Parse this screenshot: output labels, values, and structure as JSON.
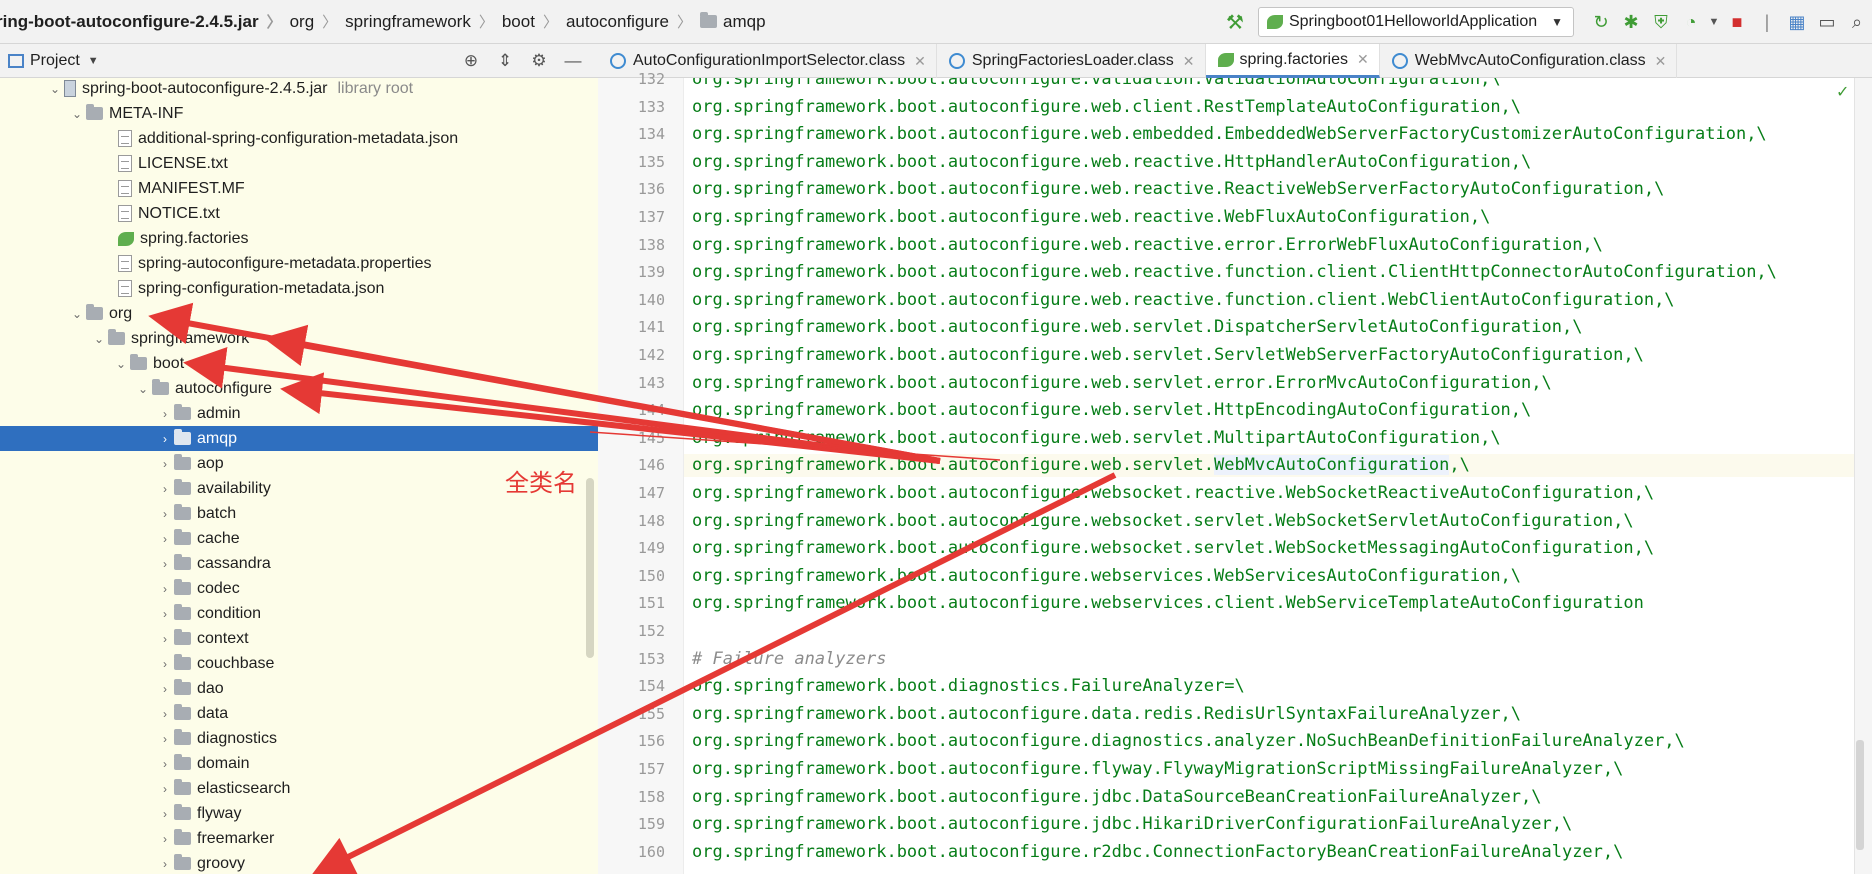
{
  "breadcrumb": {
    "items": [
      "ring-boot-autoconfigure-2.4.5.jar",
      "org",
      "springframework",
      "boot",
      "autoconfigure",
      "amqp"
    ]
  },
  "toolbar": {
    "run_config": "Springboot01HelloworldApplication"
  },
  "project_panel": {
    "title": "Project"
  },
  "tree": {
    "jar": {
      "label": "spring-boot-autoconfigure-2.4.5.jar",
      "suffix": "library root"
    },
    "meta_inf": "META-INF",
    "files": [
      "additional-spring-configuration-metadata.json",
      "LICENSE.txt",
      "MANIFEST.MF",
      "NOTICE.txt",
      "spring.factories",
      "spring-autoconfigure-metadata.properties",
      "spring-configuration-metadata.json"
    ],
    "org": "org",
    "springframework": "springframework",
    "boot": "boot",
    "autoconfigure": "autoconfigure",
    "packages": [
      "admin",
      "amqp",
      "aop",
      "availability",
      "batch",
      "cache",
      "cassandra",
      "codec",
      "condition",
      "context",
      "couchbase",
      "dao",
      "data",
      "diagnostics",
      "domain",
      "elasticsearch",
      "flyway",
      "freemarker",
      "groovy"
    ],
    "selected": "amqp"
  },
  "tabs": [
    {
      "label": "AutoConfigurationImportSelector.class",
      "active": false
    },
    {
      "label": "SpringFactoriesLoader.class",
      "active": false
    },
    {
      "label": "spring.factories",
      "active": true
    },
    {
      "label": "WebMvcAutoConfiguration.class",
      "active": false
    }
  ],
  "editor": {
    "lines": [
      {
        "n": "132",
        "text": "org.springframework.boot.autoconfigure.validation.ValidationAutoConfiguration,\\"
      },
      {
        "n": "133",
        "text": "org.springframework.boot.autoconfigure.web.client.RestTemplateAutoConfiguration,\\"
      },
      {
        "n": "134",
        "text": "org.springframework.boot.autoconfigure.web.embedded.EmbeddedWebServerFactoryCustomizerAutoConfiguration,\\"
      },
      {
        "n": "135",
        "text": "org.springframework.boot.autoconfigure.web.reactive.HttpHandlerAutoConfiguration,\\"
      },
      {
        "n": "136",
        "text": "org.springframework.boot.autoconfigure.web.reactive.ReactiveWebServerFactoryAutoConfiguration,\\"
      },
      {
        "n": "137",
        "text": "org.springframework.boot.autoconfigure.web.reactive.WebFluxAutoConfiguration,\\"
      },
      {
        "n": "138",
        "text": "org.springframework.boot.autoconfigure.web.reactive.error.ErrorWebFluxAutoConfiguration,\\"
      },
      {
        "n": "139",
        "text": "org.springframework.boot.autoconfigure.web.reactive.function.client.ClientHttpConnectorAutoConfiguration,\\"
      },
      {
        "n": "140",
        "text": "org.springframework.boot.autoconfigure.web.reactive.function.client.WebClientAutoConfiguration,\\"
      },
      {
        "n": "141",
        "text": "org.springframework.boot.autoconfigure.web.servlet.DispatcherServletAutoConfiguration,\\"
      },
      {
        "n": "142",
        "text": "org.springframework.boot.autoconfigure.web.servlet.ServletWebServerFactoryAutoConfiguration,\\"
      },
      {
        "n": "143",
        "text": "org.springframework.boot.autoconfigure.web.servlet.error.ErrorMvcAutoConfiguration,\\"
      },
      {
        "n": "144",
        "text": "org.springframework.boot.autoconfigure.web.servlet.HttpEncodingAutoConfiguration,\\"
      },
      {
        "n": "145",
        "text": "org.springframework.boot.autoconfigure.web.servlet.MultipartAutoConfiguration,\\"
      },
      {
        "n": "146",
        "text": "org.springframework.boot.autoconfigure.web.servlet.WebMvcAutoConfiguration,\\"
      },
      {
        "n": "147",
        "text": "org.springframework.boot.autoconfigure.websocket.reactive.WebSocketReactiveAutoConfiguration,\\"
      },
      {
        "n": "148",
        "text": "org.springframework.boot.autoconfigure.websocket.servlet.WebSocketServletAutoConfiguration,\\"
      },
      {
        "n": "149",
        "text": "org.springframework.boot.autoconfigure.websocket.servlet.WebSocketMessagingAutoConfiguration,\\"
      },
      {
        "n": "150",
        "text": "org.springframework.boot.autoconfigure.webservices.WebServicesAutoConfiguration,\\"
      },
      {
        "n": "151",
        "text": "org.springframework.boot.autoconfigure.webservices.client.WebServiceTemplateAutoConfiguration"
      },
      {
        "n": "152",
        "text": ""
      },
      {
        "n": "153",
        "text": "# Failure analyzers"
      },
      {
        "n": "154",
        "text": "org.springframework.boot.diagnostics.FailureAnalyzer=\\"
      },
      {
        "n": "155",
        "text": "org.springframework.boot.autoconfigure.data.redis.RedisUrlSyntaxFailureAnalyzer,\\"
      },
      {
        "n": "156",
        "text": "org.springframework.boot.autoconfigure.diagnostics.analyzer.NoSuchBeanDefinitionFailureAnalyzer,\\"
      },
      {
        "n": "157",
        "text": "org.springframework.boot.autoconfigure.flyway.FlywayMigrationScriptMissingFailureAnalyzer,\\"
      },
      {
        "n": "158",
        "text": "org.springframework.boot.autoconfigure.jdbc.DataSourceBeanCreationFailureAnalyzer,\\"
      },
      {
        "n": "159",
        "text": "org.springframework.boot.autoconfigure.jdbc.HikariDriverConfigurationFailureAnalyzer,\\"
      },
      {
        "n": "160",
        "text": "org.springframework.boot.autoconfigure.r2dbc.ConnectionFactoryBeanCreationFailureAnalyzer,\\"
      }
    ],
    "current_line": "146",
    "highlight_word": "WebMvcAutoConfiguration"
  },
  "annotation": {
    "label": "全类名",
    "color": "#e53935"
  }
}
